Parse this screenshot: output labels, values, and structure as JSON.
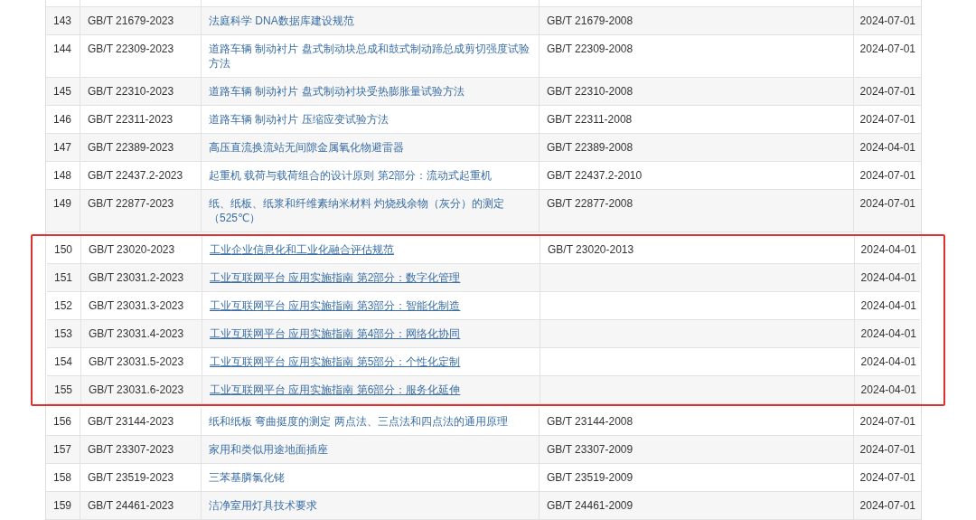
{
  "table": {
    "sections": [
      {
        "boxed": false,
        "rows": [
          {
            "no": "143",
            "code": "GB/T 21679-2023",
            "title": "法庭科学 DNA数据库建设规范",
            "replaces": "GB/T 21679-2008",
            "date": "2024-07-01",
            "underlined": false
          },
          {
            "no": "144",
            "code": "GB/T 22309-2023",
            "title": "道路车辆 制动衬片 盘式制动块总成和鼓式制动蹄总成剪切强度试验方法",
            "replaces": "GB/T 22309-2008",
            "date": "2024-07-01",
            "underlined": false
          },
          {
            "no": "145",
            "code": "GB/T 22310-2023",
            "title": "道路车辆 制动衬片 盘式制动衬块受热膨胀量试验方法",
            "replaces": "GB/T 22310-2008",
            "date": "2024-07-01",
            "underlined": false
          },
          {
            "no": "146",
            "code": "GB/T 22311-2023",
            "title": "道路车辆 制动衬片 压缩应变试验方法",
            "replaces": "GB/T 22311-2008",
            "date": "2024-07-01",
            "underlined": false
          },
          {
            "no": "147",
            "code": "GB/T 22389-2023",
            "title": "高压直流换流站无间隙金属氧化物避雷器",
            "replaces": "GB/T 22389-2008",
            "date": "2024-04-01",
            "underlined": false
          },
          {
            "no": "148",
            "code": "GB/T 22437.2-2023",
            "title": "起重机 载荷与载荷组合的设计原则 第2部分：流动式起重机",
            "replaces": "GB/T 22437.2-2010",
            "date": "2024-07-01",
            "underlined": false
          },
          {
            "no": "149",
            "code": "GB/T 22877-2023",
            "title": "纸、纸板、纸浆和纤维素纳米材料 灼烧残余物（灰分）的测定（525℃）",
            "replaces": "GB/T 22877-2008",
            "date": "2024-07-01",
            "underlined": false
          }
        ]
      },
      {
        "boxed": true,
        "rows": [
          {
            "no": "150",
            "code": "GB/T 23020-2023",
            "title": "工业企业信息化和工业化融合评估规范",
            "replaces": "GB/T 23020-2013",
            "date": "2024-04-01",
            "underlined": true
          },
          {
            "no": "151",
            "code": "GB/T 23031.2-2023",
            "title": "工业互联网平台 应用实施指南 第2部分：数字化管理",
            "date": "2024-04-01",
            "underlined": true
          },
          {
            "no": "152",
            "code": "GB/T 23031.3-2023",
            "title": "工业互联网平台 应用实施指南 第3部分：智能化制造",
            "date": "2024-04-01",
            "underlined": true
          },
          {
            "no": "153",
            "code": "GB/T 23031.4-2023",
            "title": "工业互联网平台 应用实施指南 第4部分：网络化协同",
            "date": "2024-04-01",
            "underlined": true
          },
          {
            "no": "154",
            "code": "GB/T 23031.5-2023",
            "title": "工业互联网平台 应用实施指南 第5部分：个性化定制",
            "date": "2024-04-01",
            "underlined": true
          },
          {
            "no": "155",
            "code": "GB/T 23031.6-2023",
            "title": "工业互联网平台 应用实施指南 第6部分：服务化延伸",
            "date": "2024-04-01",
            "underlined": true
          }
        ]
      },
      {
        "boxed": false,
        "rows": [
          {
            "no": "156",
            "code": "GB/T 23144-2023",
            "title": "纸和纸板 弯曲挺度的测定 两点法、三点法和四点法的通用原理",
            "replaces": "GB/T 23144-2008",
            "date": "2024-07-01",
            "underlined": false
          },
          {
            "no": "157",
            "code": "GB/T 23307-2023",
            "title": "家用和类似用途地面插座",
            "replaces": "GB/T 23307-2009",
            "date": "2024-07-01",
            "underlined": false
          },
          {
            "no": "158",
            "code": "GB/T 23519-2023",
            "title": "三苯基膦氯化铑",
            "replaces": "GB/T 23519-2009",
            "date": "2024-07-01",
            "underlined": false
          },
          {
            "no": "159",
            "code": "GB/T 24461-2023",
            "title": "洁净室用灯具技术要求",
            "replaces": "GB/T 24461-2009",
            "date": "2024-07-01",
            "underlined": false
          }
        ]
      }
    ]
  }
}
